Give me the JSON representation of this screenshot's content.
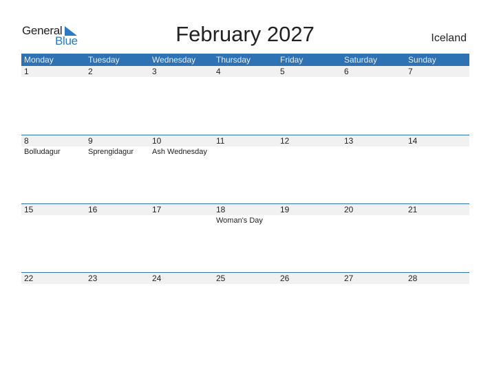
{
  "logo": {
    "general": "General",
    "blue": "Blue"
  },
  "title": "February 2027",
  "country": "Iceland",
  "colors": {
    "header_bg": "#2e72b3",
    "day_row_bg": "#f1f1f1",
    "logo_blue": "#2a7ac4"
  },
  "weekdays": [
    "Monday",
    "Tuesday",
    "Wednesday",
    "Thursday",
    "Friday",
    "Saturday",
    "Sunday"
  ],
  "weeks": [
    {
      "days": [
        "1",
        "2",
        "3",
        "4",
        "5",
        "6",
        "7"
      ],
      "events": [
        "",
        "",
        "",
        "",
        "",
        "",
        ""
      ]
    },
    {
      "days": [
        "8",
        "9",
        "10",
        "11",
        "12",
        "13",
        "14"
      ],
      "events": [
        "Bolludagur",
        "Sprengidagur",
        "Ash Wednesday",
        "",
        "",
        "",
        ""
      ]
    },
    {
      "days": [
        "15",
        "16",
        "17",
        "18",
        "19",
        "20",
        "21"
      ],
      "events": [
        "",
        "",
        "",
        "Woman's Day",
        "",
        "",
        ""
      ]
    },
    {
      "days": [
        "22",
        "23",
        "24",
        "25",
        "26",
        "27",
        "28"
      ],
      "events": [
        "",
        "",
        "",
        "",
        "",
        "",
        ""
      ]
    }
  ]
}
